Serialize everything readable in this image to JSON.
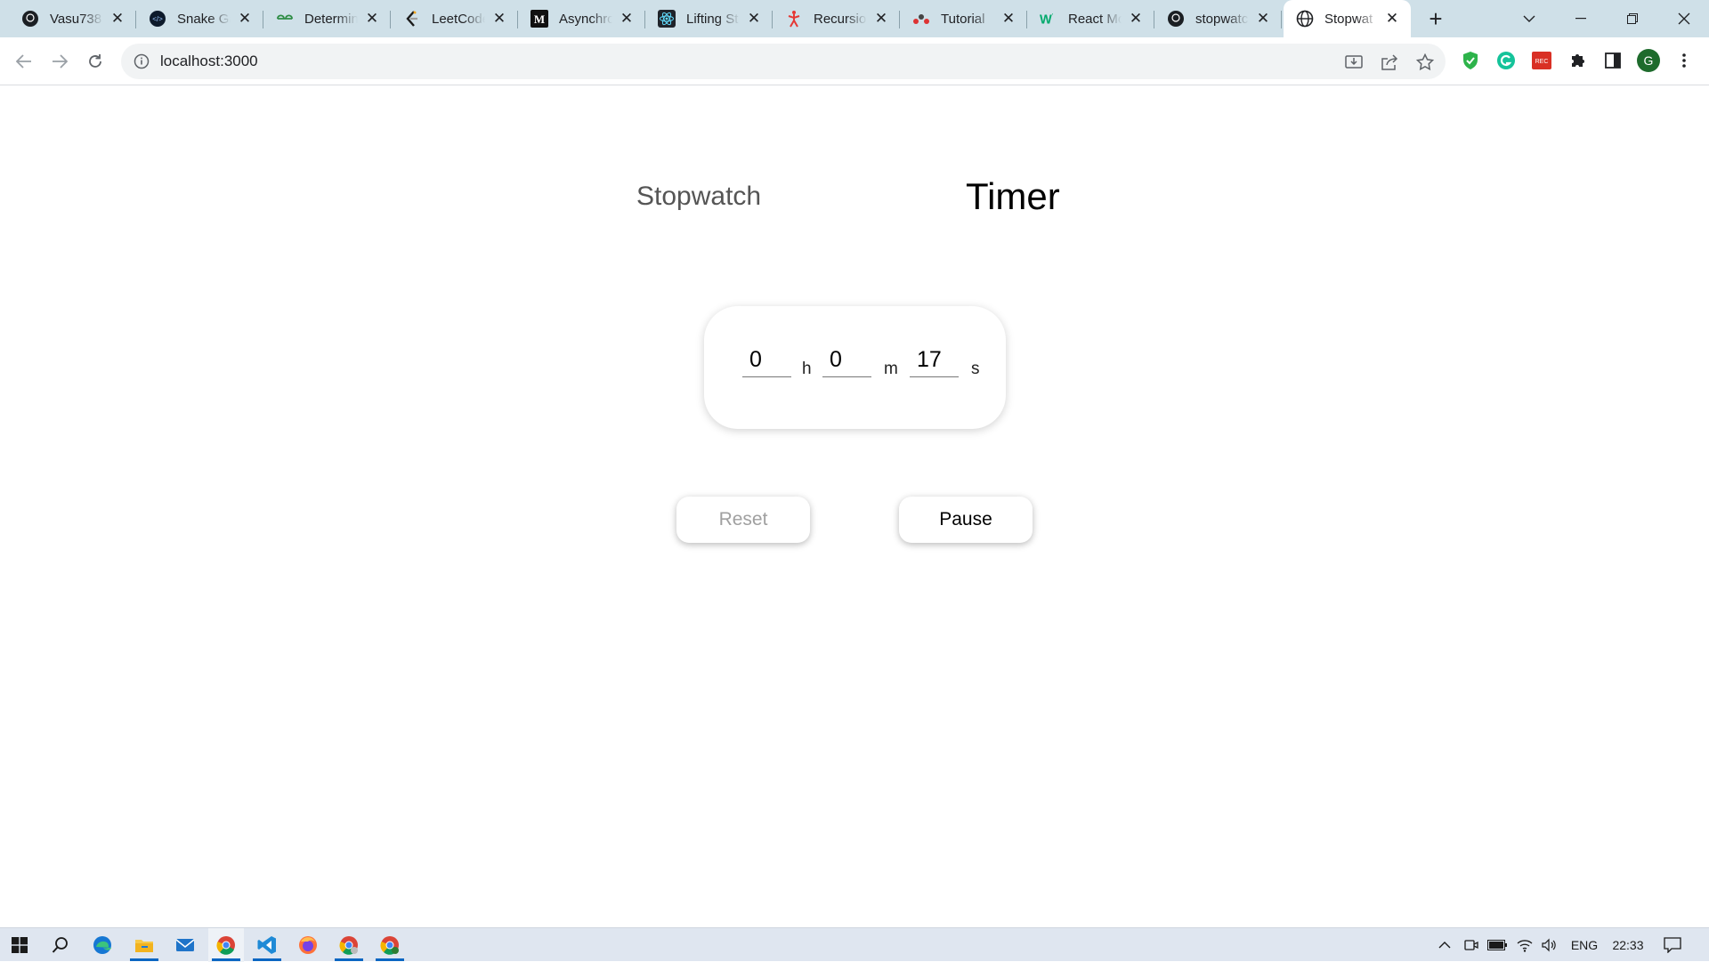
{
  "browser": {
    "tabs": [
      {
        "title": "Vasu738",
        "icon": "github-icon"
      },
      {
        "title": "Snake Ga",
        "icon": "code-icon"
      },
      {
        "title": "Determin",
        "icon": "geeksforgeeks-icon"
      },
      {
        "title": "LeetCode",
        "icon": "leetcode-icon"
      },
      {
        "title": "Asynchro",
        "icon": "medium-icon"
      },
      {
        "title": "Lifting St",
        "icon": "react-icon"
      },
      {
        "title": "Recursio",
        "icon": "figure-icon"
      },
      {
        "title": "Tutorial",
        "icon": "tutorial-icon"
      },
      {
        "title": "React Mo",
        "icon": "w-icon"
      },
      {
        "title": "stopwatc",
        "icon": "github-icon"
      },
      {
        "title": "Stopwat",
        "icon": "globe-icon",
        "active": true
      }
    ],
    "address_bar": {
      "url": "localhost:3000"
    },
    "profile_initial": "G"
  },
  "app": {
    "modes": {
      "stopwatch": "Stopwatch",
      "timer": "Timer"
    },
    "timer_inputs": {
      "hours": {
        "value": "0",
        "unit": "h"
      },
      "minutes": {
        "value": "0",
        "unit": "m"
      },
      "seconds": {
        "value": "17",
        "unit": "s"
      }
    },
    "buttons": {
      "reset": "Reset",
      "pause": "Pause"
    }
  },
  "taskbar": {
    "apps": [
      "windows-start-icon",
      "search-icon",
      "edge-icon",
      "file-explorer-icon",
      "mail-icon",
      "chrome-icon",
      "vscode-icon",
      "firefox-icon",
      "chrome-profile-icon",
      "chrome-profile-icon"
    ],
    "tray": {
      "language": "ENG",
      "time": "22:33"
    }
  },
  "colors": {
    "tabstrip_bg": "#cfe0e8",
    "taskbar_bg": "#dfe6f0",
    "accent": "#0a66c2"
  }
}
